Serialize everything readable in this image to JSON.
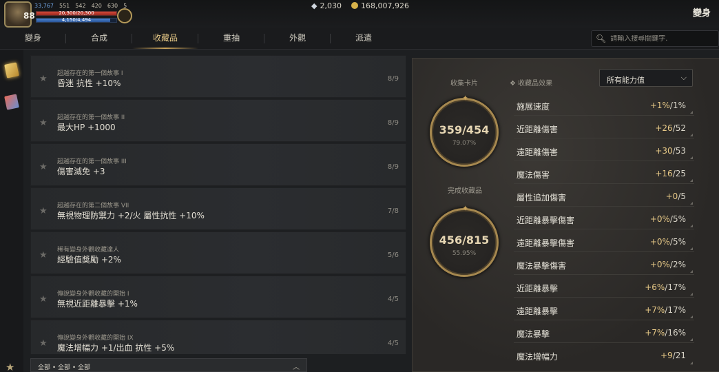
{
  "player": {
    "level": "88",
    "stat_a": "33,767",
    "stat_b": "551",
    "stat_c": "542",
    "stat_d": "420",
    "stat_e": "630",
    "stat_f": "5",
    "hp_text": "20,300/20,300",
    "hp_fill": 1.0,
    "mp_text": "4,150/4,494",
    "mp_fill": 0.92
  },
  "currency": {
    "gems": "2,030",
    "gold": "168,007,926"
  },
  "header": {
    "title": "變身"
  },
  "tabs": [
    {
      "label": "變身"
    },
    {
      "label": "合成"
    },
    {
      "label": "收藏品",
      "active": true
    },
    {
      "label": "重抽"
    },
    {
      "label": "外觀"
    },
    {
      "label": "派遣"
    }
  ],
  "search": {
    "placeholder": "請輸入搜尋關鍵字."
  },
  "collections": [
    {
      "category": "超越存在的第一個故事 I",
      "effect": "昏迷 抗性 +10%",
      "count": "8/9"
    },
    {
      "category": "超越存在的第一個故事 II",
      "effect": "最大HP +1000",
      "count": "8/9"
    },
    {
      "category": "超越存在的第一個故事 III",
      "effect": "傷害減免 +3",
      "count": "8/9"
    },
    {
      "category": "超越存在的第二個故事 VII",
      "effect": "無視物理防禦力 +2/火 屬性抗性 +10%",
      "count": "7/8"
    },
    {
      "category": "稀有變身外觀收藏達人",
      "effect": "經驗值獎勵 +2%",
      "count": "5/6"
    },
    {
      "category": "傳說變身外觀收藏的開始 I",
      "effect": "無視近距離暴擊 +1%",
      "count": "4/5"
    },
    {
      "category": "傳說變身外觀收藏的開始 IX",
      "effect": "魔法增幅力 +1/出血 抗性 +5%",
      "count": "4/5"
    }
  ],
  "filter": {
    "label": "全部 • 全部 • 全部"
  },
  "summary": {
    "cards_label": "收集卡片",
    "cards_value": "359/454",
    "cards_pct": "79.07%",
    "done_label": "完成收藏品",
    "done_value": "456/815",
    "done_pct": "55.95%"
  },
  "effects": {
    "label": "收藏品效果",
    "select_value": "所有能力值",
    "rows": [
      {
        "name": "施展速度",
        "cur": "+1%",
        "max": "/1%"
      },
      {
        "name": "近距離傷害",
        "cur": "+26",
        "max": "/52"
      },
      {
        "name": "遠距離傷害",
        "cur": "+30",
        "max": "/53"
      },
      {
        "name": "魔法傷害",
        "cur": "+16",
        "max": "/25"
      },
      {
        "name": "屬性追加傷害",
        "cur": "+0",
        "max": "/5"
      },
      {
        "name": "近距離暴擊傷害",
        "cur": "+0%",
        "max": "/5%"
      },
      {
        "name": "遠距離暴擊傷害",
        "cur": "+0%",
        "max": "/5%"
      },
      {
        "name": "魔法暴擊傷害",
        "cur": "+0%",
        "max": "/2%"
      },
      {
        "name": "近距離暴擊",
        "cur": "+6%",
        "max": "/17%"
      },
      {
        "name": "遠距離暴擊",
        "cur": "+7%",
        "max": "/17%"
      },
      {
        "name": "魔法暴擊",
        "cur": "+7%",
        "max": "/16%"
      },
      {
        "name": "魔法增幅力",
        "cur": "+9",
        "max": "/21"
      }
    ]
  },
  "colors": {
    "accent_gold": "#e7c987",
    "ring_gold": "#a6884f",
    "hp_red": "#d24a3a",
    "mp_blue": "#4a84d2"
  },
  "icons": [
    "search-icon",
    "star-icon",
    "chevron-down-icon",
    "chevron-up-icon",
    "gem-icon",
    "gold-coin-icon"
  ]
}
